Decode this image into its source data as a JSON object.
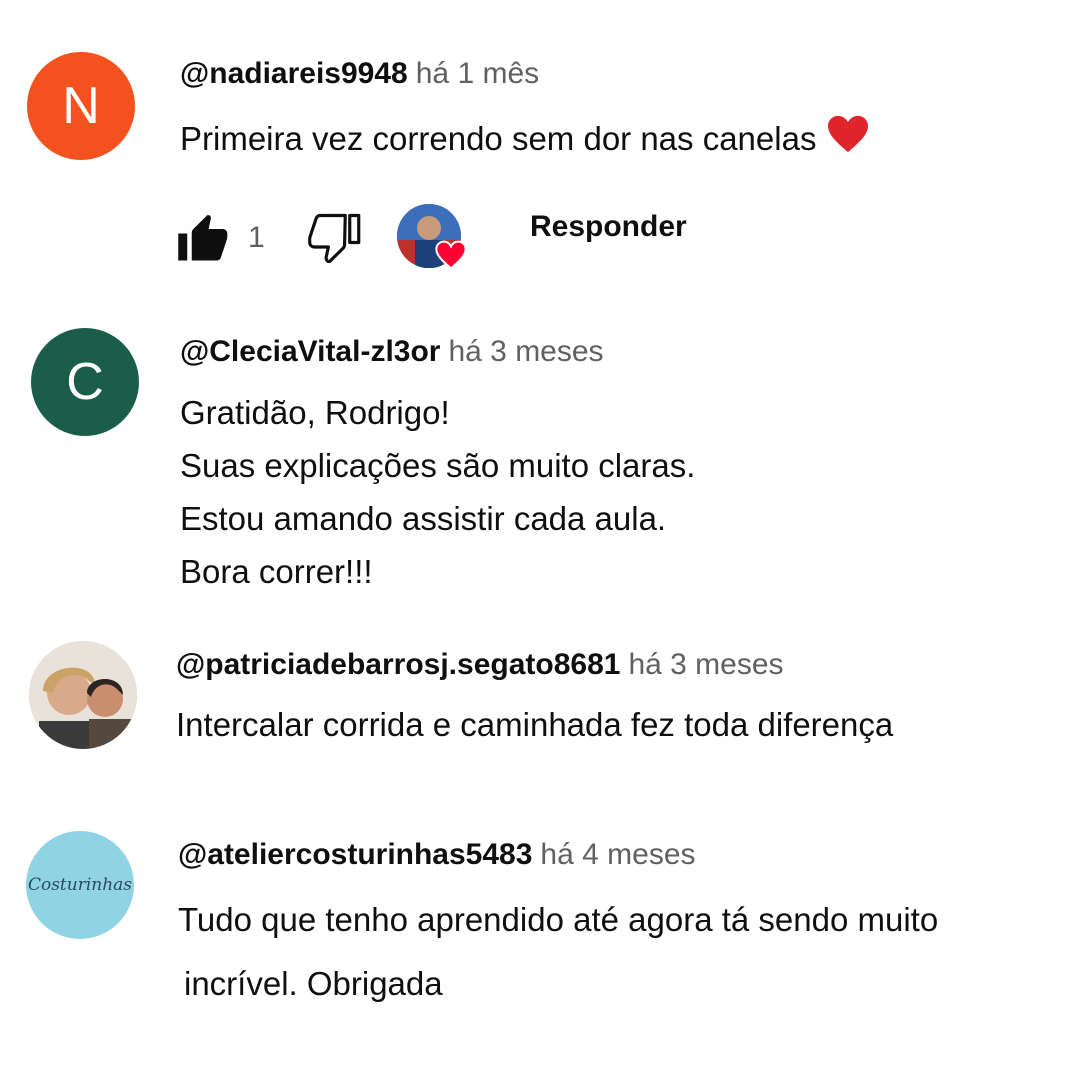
{
  "comments": [
    {
      "author": "@nadiareis9948",
      "time": "há 1 mês",
      "lines": [
        "Primeira vez correndo sem dor nas canelas"
      ],
      "avatar_letter": "N",
      "avatar_color": "#f4511e",
      "likes": "1",
      "reply_label": "Responder",
      "creator_heart": true
    },
    {
      "author": "@CleciaVital-zl3or",
      "time": "há 3 meses",
      "lines": [
        "Gratidão, Rodrigo!",
        "Suas explicações são muito claras.",
        "Estou amando assistir cada aula.",
        "Bora correr!!!"
      ],
      "avatar_letter": "C",
      "avatar_color": "#1a5e4a"
    },
    {
      "author": "@patriciadebarrosj.segato8681",
      "time": "há 3 meses",
      "lines": [
        "Intercalar corrida e caminhada fez toda diferença"
      ],
      "avatar": "photo"
    },
    {
      "author": "@ateliercosturinhas5483",
      "time": "há 4 meses",
      "lines": [
        "Tudo que tenho aprendido até agora tá sendo muito",
        "incrível. Obrigada"
      ],
      "avatar": "logo",
      "avatar_logo_text": "Costurinhas",
      "avatar_color": "#8fd3e4"
    }
  ]
}
